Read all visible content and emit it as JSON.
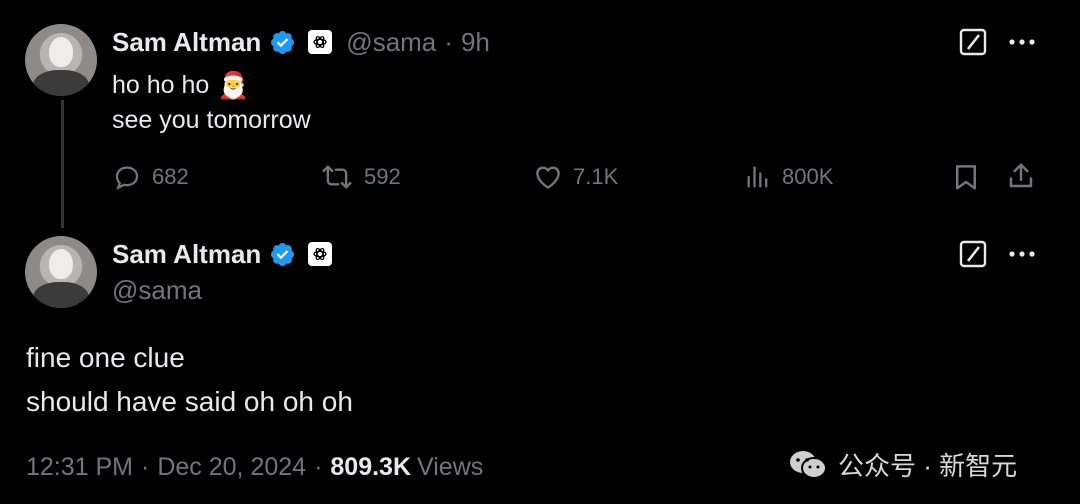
{
  "tweet1": {
    "author_name": "Sam Altman",
    "handle": "@sama",
    "separator": "·",
    "time_ago": "9h",
    "line1": "ho ho ho",
    "emoji": "🎅",
    "line2": "see you tomorrow",
    "replies": "682",
    "reposts": "592",
    "likes": "7.1K",
    "views": "800K"
  },
  "tweet2": {
    "author_name": "Sam Altman",
    "handle": "@sama",
    "line1": "fine one clue",
    "line2": "should have said oh oh oh",
    "time": "12:31 PM",
    "dot": "·",
    "date": "Dec 20, 2024",
    "dot2": "·",
    "view_count": "809.3K",
    "views_label": "Views"
  },
  "watermark": {
    "text": "公众号 · 新智元"
  },
  "colors": {
    "background": "#000000",
    "text_primary": "#e7e9ea",
    "text_secondary": "#71767b",
    "verified_blue": "#1d9bf0",
    "thread_line": "#333639"
  },
  "icons": [
    "verified-icon",
    "openai-affiliate-icon",
    "grok-icon",
    "more-icon",
    "reply-icon",
    "repost-icon",
    "like-icon",
    "views-icon",
    "bookmark-icon",
    "share-icon",
    "wechat-icon"
  ]
}
